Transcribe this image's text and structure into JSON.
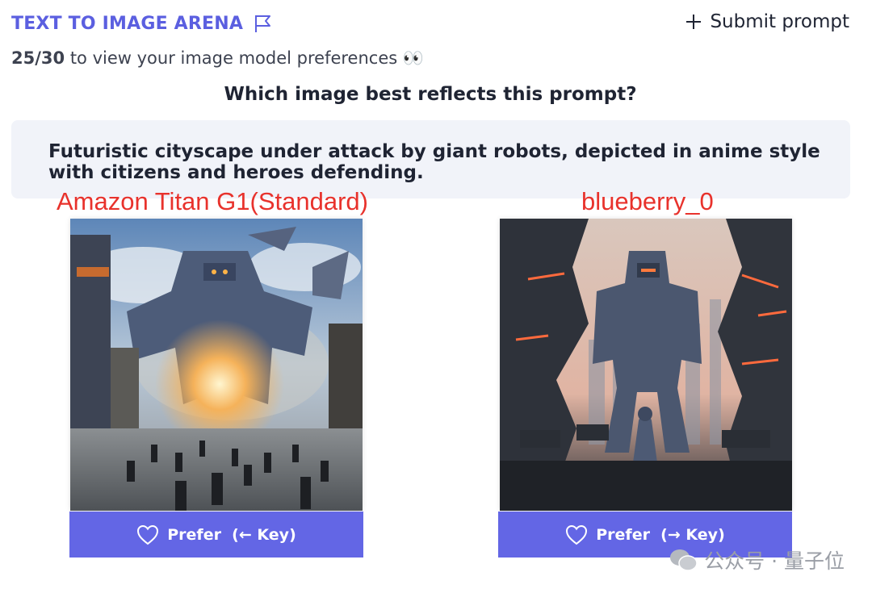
{
  "header": {
    "title": "TEXT TO IMAGE ARENA",
    "flag_icon": "flag-icon",
    "submit_label": "Submit prompt",
    "submit_icon": "plus-icon",
    "accent": "#5b5fe0"
  },
  "progress": {
    "count": "25/30",
    "text": "to view your image model preferences",
    "emoji": "👀"
  },
  "question": "Which image best reflects this prompt?",
  "prompt": "Futuristic cityscape under attack by giant robots, depicted in anime style with citizens and heroes defending.",
  "models": {
    "left": "Amazon Titan G1(Standard)",
    "right": "blueberry_0"
  },
  "buttons": {
    "left_prefer": "Prefer  (← Key)",
    "right_prefer": "Prefer  (→ Key)",
    "icon": "heart-icon",
    "color": "#6366e5"
  },
  "watermark": "公众号 · 量子位",
  "label_color": "#e8322c"
}
